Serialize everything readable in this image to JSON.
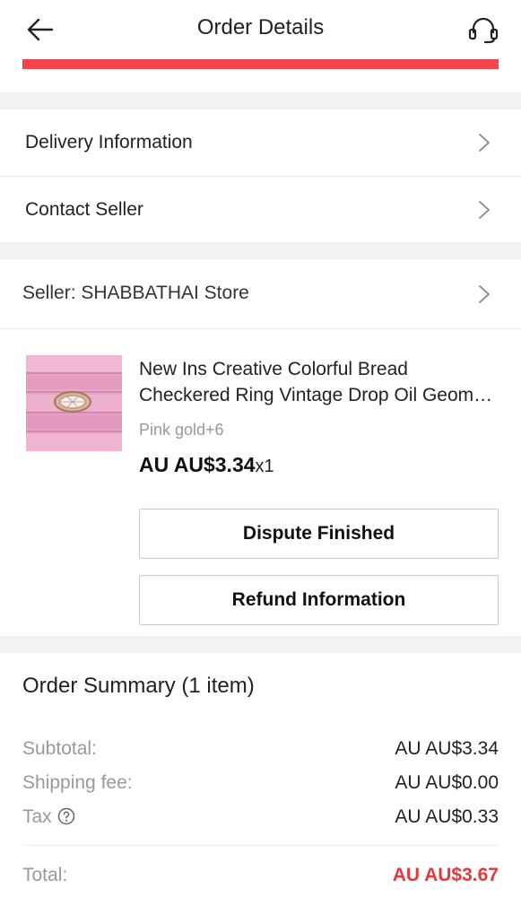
{
  "header": {
    "title": "Order Details",
    "back_icon": "back-arrow-icon",
    "support_icon": "headset-support-icon",
    "progress_color": "#f5454b"
  },
  "links": {
    "delivery_label": "Delivery Information",
    "contact_label": "Contact Seller"
  },
  "seller": {
    "label": "Seller: SHABBATHAI Store"
  },
  "product": {
    "title_line1": "New Ins Creative Colorful Bread",
    "title_line2": "Checkered Ring Vintage Drop Oil Geometric Pink Ring",
    "variant": "Pink gold+6",
    "price": "AU AU$3.34",
    "quantity": "x1"
  },
  "actions": {
    "dispute_label": "Dispute Finished",
    "refund_label": "Refund Information"
  },
  "summary": {
    "title": "Order Summary (1 item)",
    "subtotal_label": "Subtotal:",
    "subtotal_value": "AU AU$3.34",
    "shipping_label": "Shipping fee:",
    "shipping_value": "AU AU$0.00",
    "tax_label": "Tax",
    "tax_value": "AU AU$0.33",
    "total_label": "Total:",
    "total_value": "AU AU$3.67",
    "total_color": "#e8373b"
  }
}
